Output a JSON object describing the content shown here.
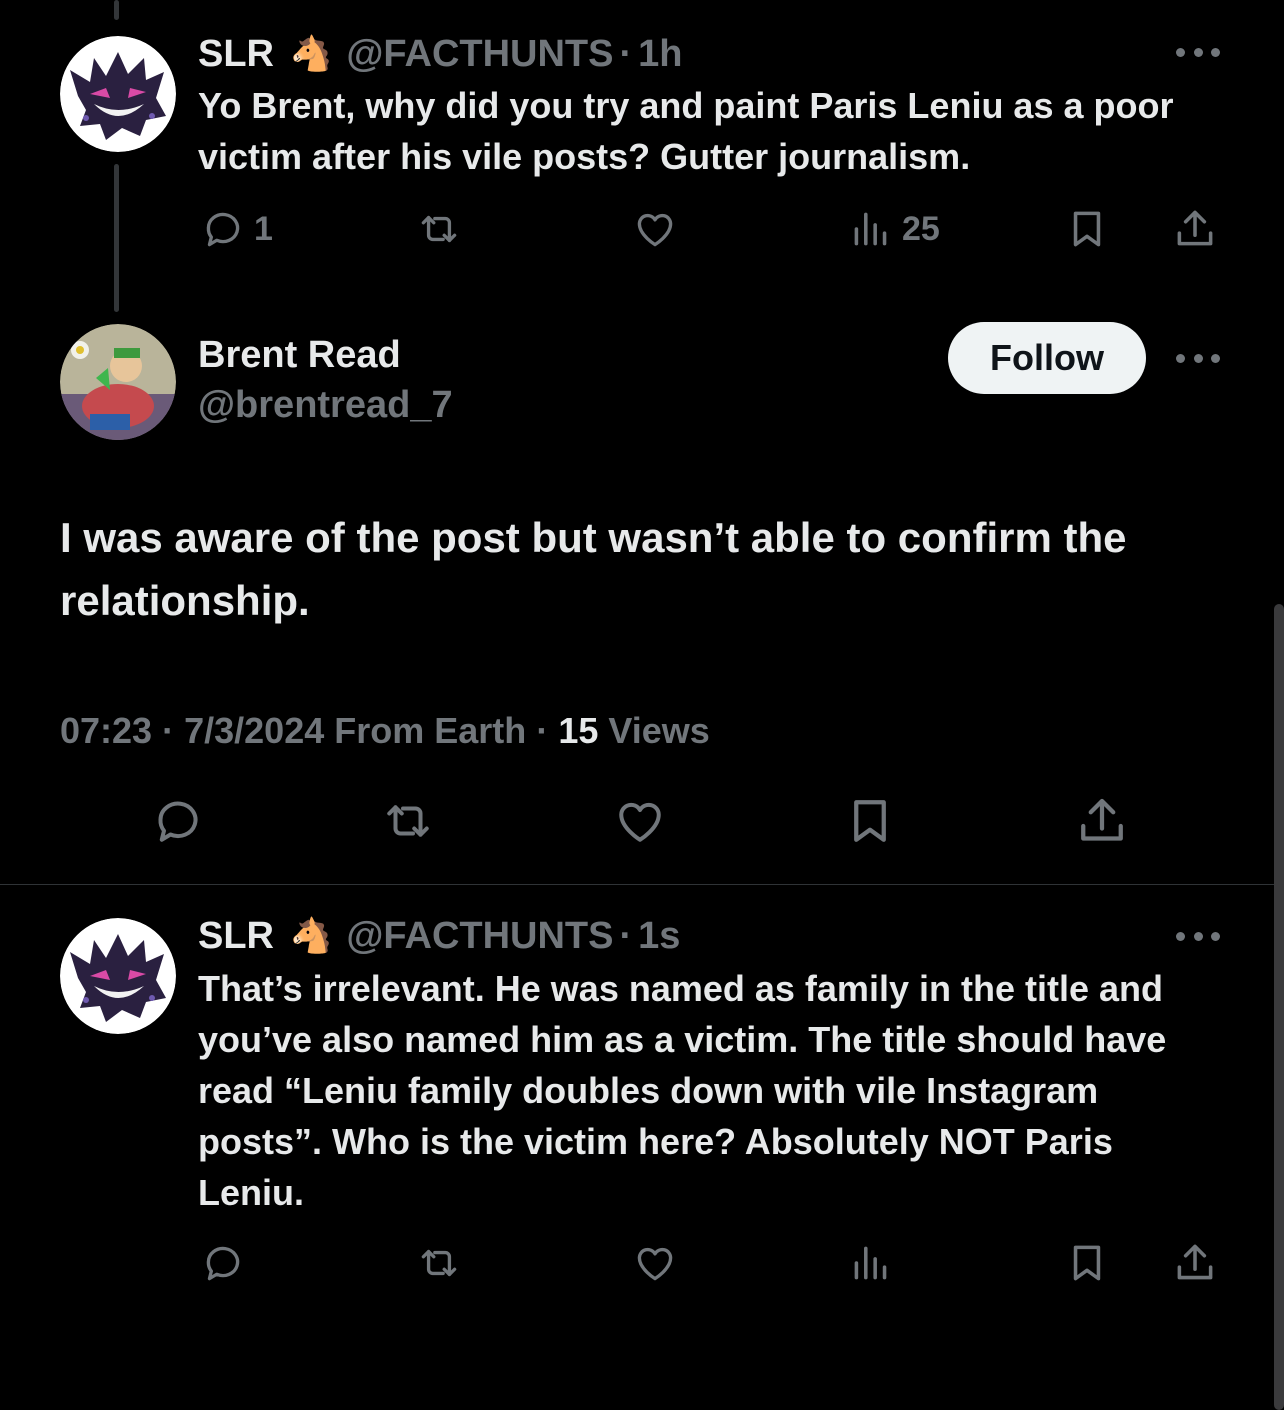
{
  "reply1": {
    "name": "SLR",
    "emoji": "🐴",
    "handle": "@FACTHUNTS",
    "separator": "·",
    "time": "1h",
    "text": "Yo Brent, why did you try and paint Paris Leniu as a poor victim after his vile posts? Gutter journalism.",
    "reply_count": "1",
    "views_count": "25"
  },
  "main": {
    "name": "Brent Read",
    "handle": "@brentread_7",
    "follow_label": "Follow",
    "text": "I was aware of the post but wasn’t able to confirm the relationship.",
    "time": "07:23",
    "date": "7/3/2024",
    "source": "From Earth",
    "sep": "·",
    "views_count": "15",
    "views_label": "Views"
  },
  "reply2": {
    "name": "SLR",
    "emoji": "🐴",
    "handle": "@FACTHUNTS",
    "separator": "·",
    "time": "1s",
    "text": "That’s irrelevant. He was named as family in the title and you’ve also named him as a victim. The title should have read “Leniu family doubles down with vile Instagram posts”. Who is the victim here? Absolutely NOT Paris Leniu."
  },
  "colors": {
    "background": "#000000",
    "text_primary": "#e7e9ea",
    "text_secondary": "#71767b",
    "follow_bg": "#eff3f4"
  },
  "icons": [
    "reply-icon",
    "retweet-icon",
    "like-icon",
    "views-icon",
    "bookmark-icon",
    "share-icon",
    "more-icon"
  ]
}
